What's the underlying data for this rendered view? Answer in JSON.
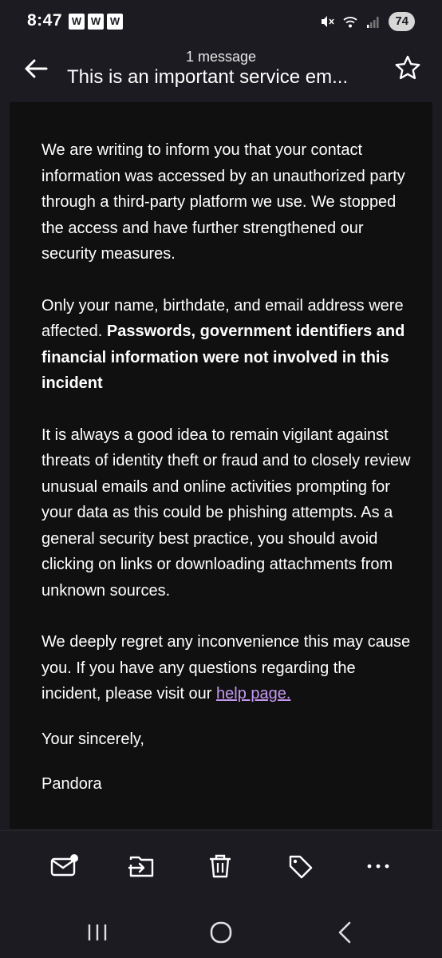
{
  "status_bar": {
    "time": "8:47",
    "notifications": [
      "W",
      "W",
      "W"
    ],
    "battery": "74"
  },
  "header": {
    "subtitle": "1 message",
    "title": "This is an important service em..."
  },
  "message": {
    "p1": "We are writing to inform you that your contact information was accessed by an unauthorized party through a third-party platform we use. We stopped the access and have further strengthened our security measures.",
    "p2_plain": "Only your name, birthdate, and email address were affected. ",
    "p2_bold": "Passwords, government identifiers and financial information were not involved in this incident",
    "p3": "It is always a good idea to remain vigilant against threats of identity theft or fraud and to closely review unusual emails and online activities prompting for your data as this could be phishing attempts. As a general security best practice, you should avoid clicking on links or downloading attachments from unknown sources.",
    "p4_plain": "We deeply regret any inconvenience this may cause you. If you have any questions regarding the incident, please visit our ",
    "p4_link": "help page.",
    "closing": "Your sincerely,",
    "signature": "Pandora"
  },
  "colors": {
    "background": "#1c1b22",
    "message_background": "#101010",
    "link": "#c597f0"
  },
  "icons": {
    "back": "arrow-left-icon",
    "star": "star-icon",
    "mark_unread": "mail-unread-icon",
    "move": "move-to-icon",
    "delete": "trash-icon",
    "label": "tag-icon",
    "more": "more-icon",
    "nav_recents": "recents-icon",
    "nav_home": "home-icon",
    "nav_back": "back-icon"
  }
}
